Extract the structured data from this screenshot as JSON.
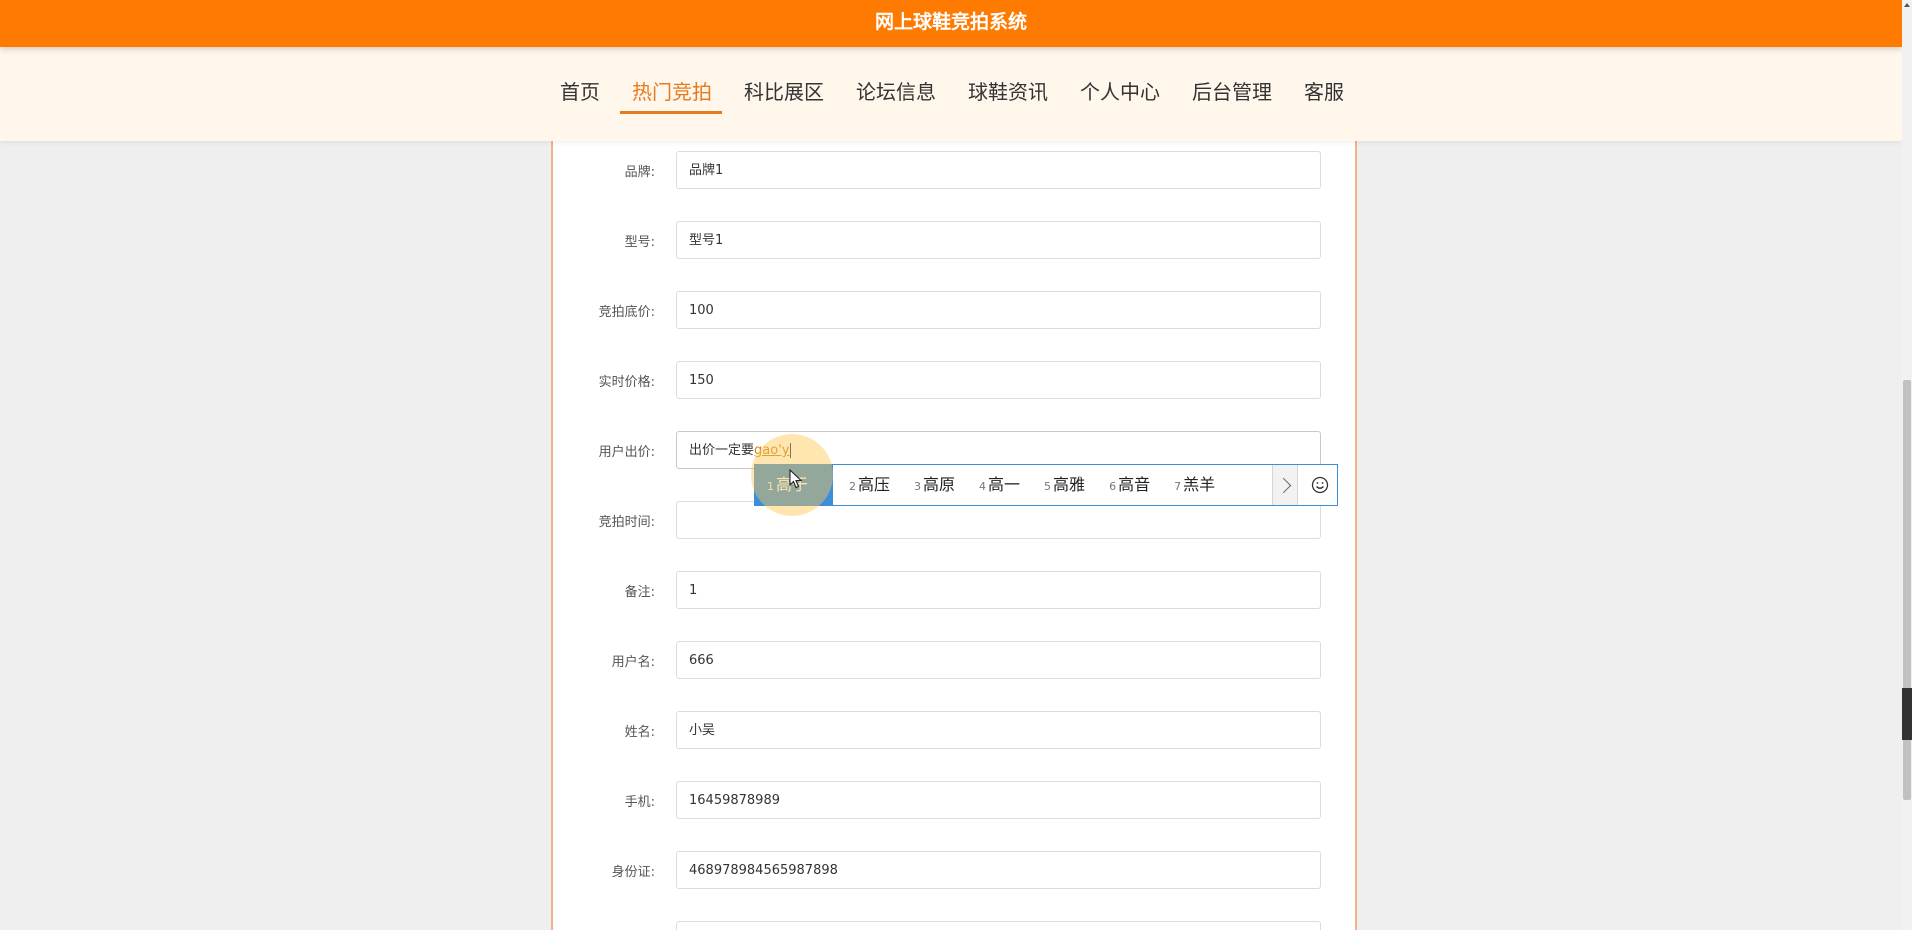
{
  "header": {
    "title": "网上球鞋竞拍系统"
  },
  "nav": {
    "items": [
      {
        "label": "首页"
      },
      {
        "label": "热门竞拍",
        "active": true
      },
      {
        "label": "科比展区"
      },
      {
        "label": "论坛信息"
      },
      {
        "label": "球鞋资讯"
      },
      {
        "label": "个人中心"
      },
      {
        "label": "后台管理"
      },
      {
        "label": "客服"
      }
    ]
  },
  "form": {
    "brand": {
      "label": "品牌:",
      "value": "品牌1"
    },
    "model": {
      "label": "型号:",
      "value": "型号1"
    },
    "base_price": {
      "label": "竞拍底价:",
      "value": "100"
    },
    "live_price": {
      "label": "实时价格:",
      "value": "150"
    },
    "user_bid": {
      "label": "用户出价:",
      "value": "出价一定要",
      "composition": "gao'y"
    },
    "auction_time": {
      "label": "竞拍时间:",
      "value": ""
    },
    "remark": {
      "label": "备注:",
      "value": "1"
    },
    "username": {
      "label": "用户名:",
      "value": "666"
    },
    "name": {
      "label": "姓名:",
      "value": "小吴"
    },
    "phone": {
      "label": "手机:",
      "value": "16459878989"
    },
    "id_card": {
      "label": "身份证:",
      "value": "468978984565987898"
    }
  },
  "ime": {
    "candidates": [
      {
        "num": "1",
        "text": "高于"
      },
      {
        "num": "2",
        "text": "高压"
      },
      {
        "num": "3",
        "text": "高原"
      },
      {
        "num": "4",
        "text": "高一"
      },
      {
        "num": "5",
        "text": "高雅"
      },
      {
        "num": "6",
        "text": "高音"
      },
      {
        "num": "7",
        "text": "羔羊"
      }
    ],
    "colors": {
      "selected": "#3b8fd9"
    }
  },
  "colors": {
    "accent": "#ff7a00",
    "nav_active": "#e67a1e",
    "nav_bg": "#fff6ec"
  }
}
